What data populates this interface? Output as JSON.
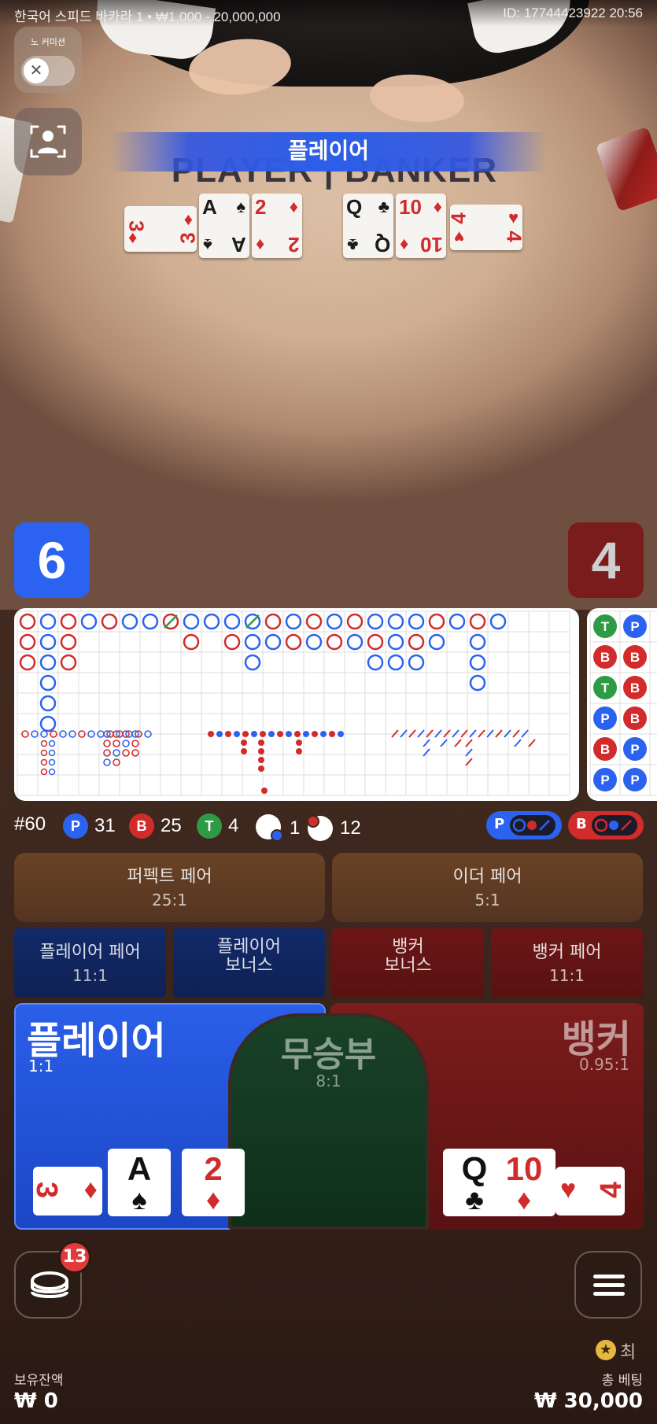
{
  "header": {
    "table_name": "한국어 스피드 바카라 1 • ₩1,000 - 20,000,000",
    "round_id": "ID: 17744423922 20:56"
  },
  "no_commission": {
    "label": "노 커미션",
    "close_glyph": "✕"
  },
  "result_banner": "플레이어",
  "table_print": {
    "left": "PLAYER",
    "right": "BANKER"
  },
  "table_cards": {
    "player": [
      {
        "rank": "3",
        "suit": "♦",
        "color": "red"
      },
      {
        "rank": "A",
        "suit": "♠",
        "color": "black"
      },
      {
        "rank": "2",
        "suit": "♦",
        "color": "red"
      }
    ],
    "banker": [
      {
        "rank": "Q",
        "suit": "♣",
        "color": "black"
      },
      {
        "rank": "10",
        "suit": "♦",
        "color": "red"
      },
      {
        "rank": "4",
        "suit": "♥",
        "color": "red"
      }
    ]
  },
  "scores": {
    "player": "6",
    "banker": "4"
  },
  "stats": {
    "round": "#60",
    "player_label": "P",
    "player_count": "31",
    "banker_label": "B",
    "banker_count": "25",
    "tie_label": "T",
    "tie_count": "4",
    "player_pair_count": "1",
    "banker_pair_count": "12"
  },
  "predictions": {
    "player_label": "P",
    "banker_label": "B"
  },
  "side_bets": {
    "perfect_pair": {
      "name": "퍼펙트 페어",
      "odds": "25:1"
    },
    "either_pair": {
      "name": "이더 페어",
      "odds": "5:1"
    },
    "player_pair": {
      "name": "플레이어 페어",
      "odds": "11:1"
    },
    "player_bonus": {
      "name": "플레이어\n보너스"
    },
    "banker_bonus": {
      "name": "뱅커\n보너스"
    },
    "banker_pair": {
      "name": "뱅커 페어",
      "odds": "11:1"
    }
  },
  "main_bets": {
    "player": {
      "name": "플레이어",
      "odds": "1:1"
    },
    "tie": {
      "name": "무승부",
      "odds": "8:1"
    },
    "banker": {
      "name": "뱅커",
      "odds": "0.95:1"
    }
  },
  "bet_cards": {
    "player": [
      {
        "rank": "3",
        "suit": "♦"
      },
      {
        "rank": "A",
        "suit": "♠"
      },
      {
        "rank": "2",
        "suit": "♦"
      }
    ],
    "banker": [
      {
        "rank": "Q",
        "suit": "♣"
      },
      {
        "rank": "10",
        "suit": "♦"
      },
      {
        "rank": "4",
        "suit": "♥"
      }
    ]
  },
  "chips_badge": "13",
  "star_label": "최",
  "balance": {
    "label": "보유잔액",
    "value": "₩ 0"
  },
  "total_bet": {
    "label": "총 베팅",
    "value": "₩ 30,000"
  },
  "bead_road": [
    [
      "T",
      "P"
    ],
    [
      "B",
      "B"
    ],
    [
      "T",
      "B"
    ],
    [
      "P",
      "B"
    ],
    [
      "B",
      "P"
    ],
    [
      "P",
      "P"
    ]
  ],
  "colors": {
    "player": "#2b63f0",
    "banker": "#d22b2b",
    "tie": "#2f9a44"
  }
}
